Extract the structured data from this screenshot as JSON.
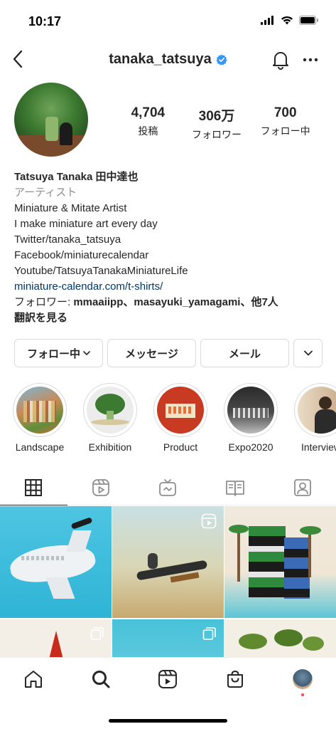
{
  "status_bar": {
    "time": "10:17"
  },
  "header": {
    "username": "tanaka_tatsuya",
    "verified": true,
    "verified_color": "#3897f0"
  },
  "profile": {
    "stats": [
      {
        "value": "4,704",
        "label": "投稿"
      },
      {
        "value": "306万",
        "label": "フォロワー"
      },
      {
        "value": "700",
        "label": "フォロー中"
      }
    ],
    "name": "Tatsuya Tanaka 田中達也",
    "category": "アーティスト",
    "bio_lines": [
      "Miniature & Mitate Artist",
      "I make miniature art every day",
      "Twitter/tanaka_tatsuya",
      "Facebook/miniaturecalendar",
      "Youtube/TatsuyaTanakaMiniatureLife"
    ],
    "link": "miniature-calendar.com/t-shirts/",
    "followed_by_prefix": "フォロワー: ",
    "followed_by_names": "mmaaiipp、masayuki_yamagami、他7人",
    "translate": "翻訳を見る"
  },
  "actions": {
    "follow": "フォロー中",
    "message": "メッセージ",
    "mail": "メール"
  },
  "highlights": [
    {
      "label": "Landscape",
      "icon": "landscape-thumb"
    },
    {
      "label": "Exhibition",
      "icon": "broccoli-thumb"
    },
    {
      "label": "Product",
      "icon": "product-thumb"
    },
    {
      "label": "Expo2020",
      "icon": "expo-thumb"
    },
    {
      "label": "Interview",
      "icon": "interview-thumb"
    }
  ],
  "tabs": [
    {
      "name": "grid",
      "icon": "grid-icon",
      "active": true
    },
    {
      "name": "reels",
      "icon": "reels-icon",
      "active": false
    },
    {
      "name": "igtv",
      "icon": "tv-icon",
      "active": false
    },
    {
      "name": "guides",
      "icon": "guide-icon",
      "active": false
    },
    {
      "name": "tagged",
      "icon": "tagged-icon",
      "active": false
    }
  ],
  "bottom_nav": [
    "home-icon",
    "search-icon",
    "reels-icon",
    "shop-icon",
    "profile-avatar"
  ],
  "colors": {
    "link": "#00376b",
    "accent": "#3897f0",
    "border": "#dbdbdb",
    "muted": "#8e8e8e"
  }
}
